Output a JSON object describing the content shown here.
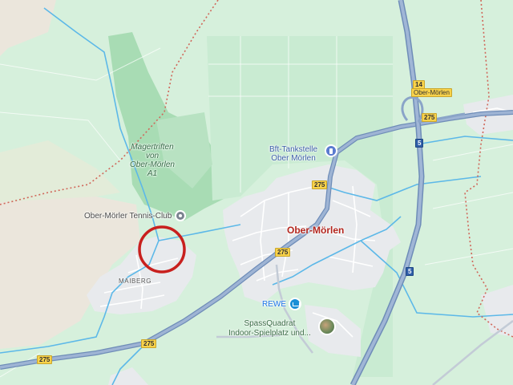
{
  "map": {
    "town": "Ober-Mörlen",
    "district": "MAIBERG",
    "nature_area": [
      "Magertriften",
      "von",
      "Ober-Mörlen",
      "A1"
    ],
    "pois": {
      "tennis_club": "Ober-Mörler Tennis-Club",
      "fuel_station": [
        "Bft-Tankstelle",
        "Ober Mörlen"
      ],
      "supermarket": "REWE",
      "playground": [
        "SpassQuadrat",
        "Indoor-Spielplatz und..."
      ]
    },
    "road_shields": {
      "b275": "275",
      "a5": "5",
      "exit_number": "14",
      "exit_name": "Ober-Mörlen"
    },
    "icons": {
      "tennis": "tennis-club-pin-icon",
      "fuel": "fuel-station-icon",
      "shop": "shopping-cart-icon",
      "playground": "playground-photo-icon"
    },
    "colors": {
      "land": "#d6f0dc",
      "forest": "#a8dcb4",
      "field": "#ebe6dc",
      "settlement": "#e8eaed",
      "highway": "#8aa4c8",
      "water": "#5cb8e8",
      "border": "#d0675a",
      "highlight_circle": "#c8201e",
      "town_label": "#b3261e"
    }
  }
}
